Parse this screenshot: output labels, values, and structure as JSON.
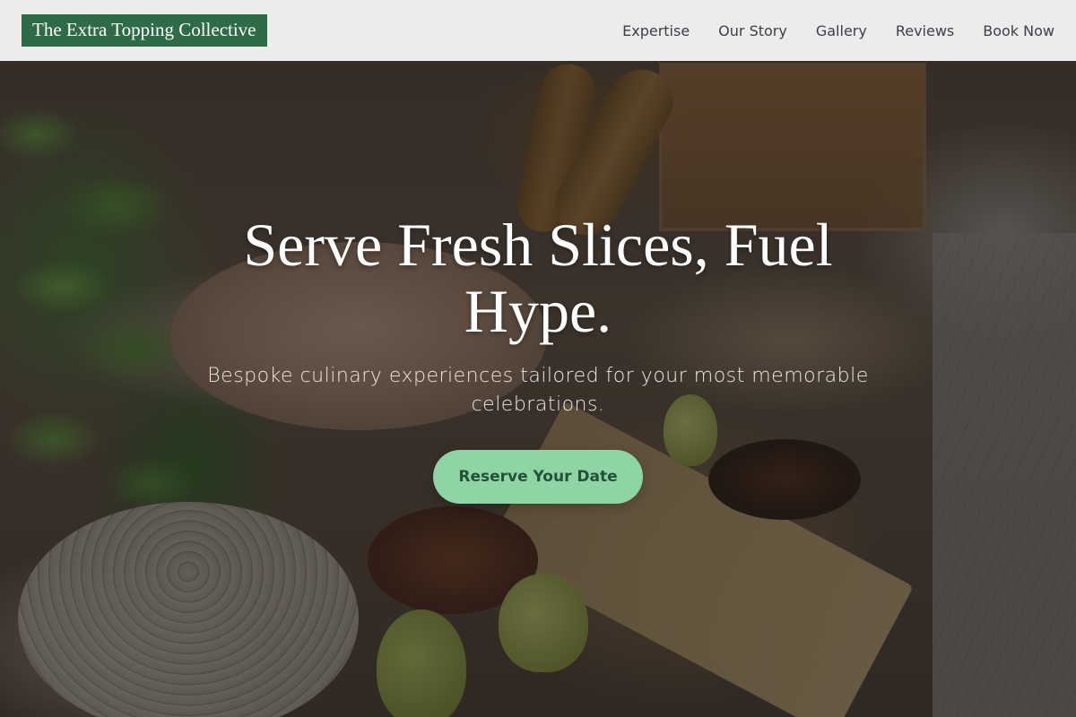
{
  "header": {
    "brand": "The Extra Topping Collective",
    "nav": [
      {
        "label": "Expertise"
      },
      {
        "label": "Our Story"
      },
      {
        "label": "Gallery"
      },
      {
        "label": "Reviews"
      },
      {
        "label": "Book Now"
      }
    ]
  },
  "hero": {
    "headline": "Serve Fresh Slices, Fuel Hype.",
    "subtitle": "Bespoke culinary experiences tailored for your most memorable celebrations.",
    "cta_label": "Reserve Your Date",
    "background_description_icon": "catering-buffet-photo"
  },
  "colors": {
    "brand_green": "#2f6b46",
    "cta_bg": "#8fd4a4",
    "cta_text": "#24503a",
    "nav_text": "#3a3f4a",
    "header_bg": "#f5f5f4"
  }
}
